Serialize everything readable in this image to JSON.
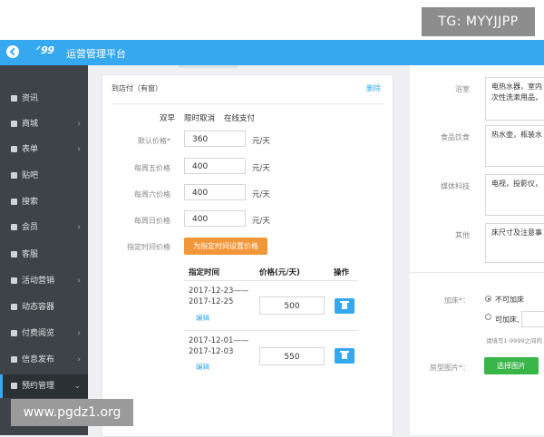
{
  "watermark_top": "TG: MYYJJPP",
  "watermark_bottom": "www.pgdz1.org",
  "header": {
    "logo": "ᐟ𝟵𝟵",
    "title": "运营管理平台"
  },
  "sidebar": {
    "items": [
      {
        "label": "资讯",
        "arrow": ""
      },
      {
        "label": "商城",
        "arrow": "›"
      },
      {
        "label": "表单",
        "arrow": "›"
      },
      {
        "label": "贴吧",
        "arrow": ""
      },
      {
        "label": "搜索",
        "arrow": ""
      },
      {
        "label": "会员",
        "arrow": "›"
      },
      {
        "label": "客服",
        "arrow": ""
      },
      {
        "label": "活动营销",
        "arrow": "›"
      },
      {
        "label": "动态容器",
        "arrow": ""
      },
      {
        "label": "付费阅览",
        "arrow": "›"
      },
      {
        "label": "信息发布",
        "arrow": "›"
      },
      {
        "label": "预约管理",
        "arrow": "⌄"
      }
    ]
  },
  "card": {
    "title": "到店付（有窗）",
    "delete": "删除",
    "options": [
      "双早",
      "限时取消",
      "在线支付"
    ],
    "fields": [
      {
        "label": "默认价格*",
        "value": "360",
        "unit": "元/天"
      },
      {
        "label": "每周五价格",
        "value": "400",
        "unit": "元/天"
      },
      {
        "label": "每周六价格",
        "value": "400",
        "unit": "元/天"
      },
      {
        "label": "每周日价格",
        "value": "400",
        "unit": "元/天"
      }
    ],
    "special_label": "指定时间价格",
    "special_button": "为指定时间设置价格",
    "table": {
      "headers": [
        "指定时间",
        "价格(元/天)",
        "操作"
      ],
      "rows": [
        {
          "start": "2017-12-23——",
          "end": "2017-12-25",
          "edit": "编辑",
          "price": "500"
        },
        {
          "start": "2017-12-01——",
          "end": "2017-12-03",
          "edit": "编辑",
          "price": "550"
        }
      ]
    }
  },
  "right": {
    "fields": [
      {
        "label": "浴室",
        "value_line1": "电热水器，室内",
        "value_line2": "次性洗漱用品，"
      },
      {
        "label": "食品饮食",
        "value_line1": "热水壶，瓶装水",
        "value_line2": ""
      },
      {
        "label": "媒体科技",
        "value_line1": "电视，投影仪，",
        "value_line2": ""
      },
      {
        "label": "其他",
        "value_line1": "床尺寸及注意事",
        "value_line2": ""
      }
    ],
    "extra_bed_label": "加床*：",
    "extra_bed_options": [
      "不可加床",
      "可加床,"
    ],
    "hint": "请填写1-9999之间的",
    "room_image_label": "房型图片*：",
    "room_image_button": "选择图片"
  }
}
